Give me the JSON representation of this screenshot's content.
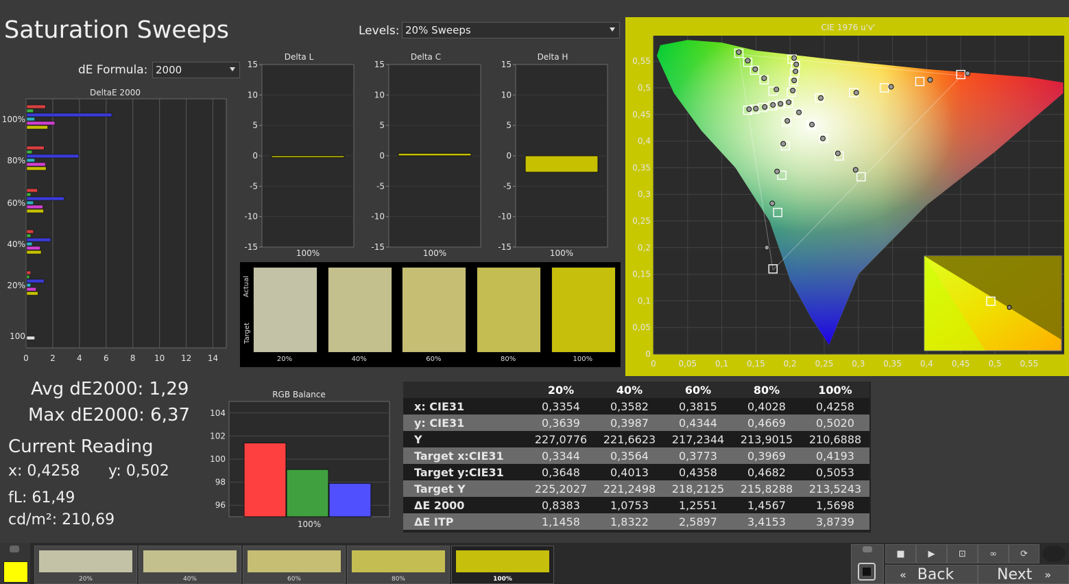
{
  "title": "Saturation Sweeps",
  "levels": {
    "label": "Levels:",
    "value": "20% Sweeps"
  },
  "de_formula": {
    "label": "dE Formula:",
    "value": "2000"
  },
  "summary": {
    "avg": "Avg dE2000: 1,29",
    "max": "Max dE2000: 6,37",
    "current_title": "Current Reading",
    "x": "x: 0,4258",
    "y": "y: 0,502",
    "fl": "fL: 61,49",
    "cdm": "cd/m²: 210,69"
  },
  "colors": {
    "bg": "#3a3a3a",
    "plot_bg": "#2b2b2b",
    "yellow": "#c6c000",
    "highlight_border": "#c8c800"
  },
  "chart_data": [
    {
      "type": "bar",
      "title": "DeltaE 2000",
      "orientation": "horizontal",
      "xlim": [
        0,
        15
      ],
      "x_ticks": [
        "0",
        "2",
        "4",
        "6",
        "8",
        "10",
        "12",
        "14"
      ],
      "categories": [
        "100%",
        "80%",
        "60%",
        "40%",
        "20%",
        "100"
      ],
      "series": [
        {
          "color": "#d94040",
          "values": [
            1.4,
            1.3,
            0.8,
            0.5,
            0.3,
            null
          ]
        },
        {
          "color": "#40b040",
          "values": [
            0.5,
            0.4,
            0.3,
            0.3,
            0.2,
            null
          ]
        },
        {
          "color": "#3b3bd9",
          "values": [
            6.37,
            3.9,
            2.8,
            1.8,
            1.3,
            null
          ]
        },
        {
          "color": "#30b0c0",
          "values": [
            0.6,
            0.6,
            0.5,
            0.4,
            0.3,
            null
          ]
        },
        {
          "color": "#d040d0",
          "values": [
            2.1,
            1.4,
            1.2,
            1.0,
            0.7,
            null
          ]
        },
        {
          "color": "#c6c000",
          "values": [
            1.57,
            1.45,
            1.26,
            1.08,
            0.84,
            null
          ]
        },
        {
          "color": "#e0e0e0",
          "values": [
            null,
            null,
            null,
            null,
            null,
            0.6
          ]
        }
      ]
    },
    {
      "type": "bar",
      "title": "Delta L",
      "ylim": [
        -15,
        15
      ],
      "y_ticks": [
        "15",
        "10",
        "5",
        "0",
        "-5",
        "-10",
        "-15"
      ],
      "categories": [
        "100%"
      ],
      "values": [
        -0.3
      ]
    },
    {
      "type": "bar",
      "title": "Delta C",
      "ylim": [
        -15,
        15
      ],
      "y_ticks": [
        "15",
        "10",
        "5",
        "0",
        "-5",
        "-10",
        "-15"
      ],
      "categories": [
        "100%"
      ],
      "values": [
        0.4
      ]
    },
    {
      "type": "bar",
      "title": "Delta H",
      "ylim": [
        -15,
        15
      ],
      "y_ticks": [
        "15",
        "10",
        "5",
        "0",
        "-5",
        "-10",
        "-15"
      ],
      "categories": [
        "100%"
      ],
      "values": [
        -2.7
      ]
    },
    {
      "type": "bar",
      "title": "RGB Balance",
      "ylim": [
        95,
        105
      ],
      "y_ticks": [
        "104",
        "102",
        "100",
        "98",
        "96"
      ],
      "categories": [
        "100%"
      ],
      "series": [
        {
          "color": "#ff4040",
          "values": [
            101.4
          ]
        },
        {
          "color": "#40a040",
          "values": [
            99.1
          ]
        },
        {
          "color": "#5050ff",
          "values": [
            97.9
          ]
        }
      ]
    },
    {
      "type": "scatter",
      "title": "CIE 1976 u'v'",
      "xlim": [
        0,
        0.6
      ],
      "ylim": [
        0,
        0.6
      ],
      "x_ticks": [
        "0",
        "0,05",
        "0,1",
        "0,15",
        "0,2",
        "0,25",
        "0,3",
        "0,35",
        "0,4",
        "0,45",
        "0,5",
        "0,55"
      ],
      "y_ticks": [
        "0",
        "0,05",
        "0,1",
        "0,15",
        "0,2",
        "0,25",
        "0,3",
        "0,35",
        "0,4",
        "0,45",
        "0,5",
        "0,55"
      ],
      "targets": [
        [
          0.125,
          0.565
        ],
        [
          0.138,
          0.548
        ],
        [
          0.148,
          0.533
        ],
        [
          0.162,
          0.515
        ],
        [
          0.175,
          0.494
        ],
        [
          0.198,
          0.471
        ],
        [
          0.203,
          0.554
        ],
        [
          0.208,
          0.542
        ],
        [
          0.207,
          0.528
        ],
        [
          0.205,
          0.512
        ],
        [
          0.202,
          0.492
        ],
        [
          0.138,
          0.458
        ],
        [
          0.148,
          0.46
        ],
        [
          0.16,
          0.463
        ],
        [
          0.174,
          0.466
        ],
        [
          0.185,
          0.469
        ],
        [
          0.212,
          0.452
        ],
        [
          0.231,
          0.43
        ],
        [
          0.249,
          0.405
        ],
        [
          0.272,
          0.372
        ],
        [
          0.304,
          0.333
        ],
        [
          0.195,
          0.436
        ],
        [
          0.193,
          0.391
        ],
        [
          0.188,
          0.336
        ],
        [
          0.182,
          0.266
        ],
        [
          0.175,
          0.16
        ],
        [
          0.243,
          0.481
        ],
        [
          0.293,
          0.491
        ],
        [
          0.338,
          0.5
        ],
        [
          0.39,
          0.512
        ],
        [
          0.45,
          0.525
        ]
      ],
      "measured": [
        [
          0.125,
          0.567
        ],
        [
          0.138,
          0.551
        ],
        [
          0.149,
          0.535
        ],
        [
          0.162,
          0.518
        ],
        [
          0.18,
          0.497
        ],
        [
          0.198,
          0.473
        ],
        [
          0.206,
          0.556
        ],
        [
          0.209,
          0.544
        ],
        [
          0.208,
          0.531
        ],
        [
          0.206,
          0.514
        ],
        [
          0.204,
          0.495
        ],
        [
          0.14,
          0.46
        ],
        [
          0.15,
          0.461
        ],
        [
          0.163,
          0.464
        ],
        [
          0.175,
          0.468
        ],
        [
          0.186,
          0.47
        ],
        [
          0.213,
          0.454
        ],
        [
          0.232,
          0.431
        ],
        [
          0.248,
          0.405
        ],
        [
          0.27,
          0.377
        ],
        [
          0.296,
          0.346
        ],
        [
          0.196,
          0.438
        ],
        [
          0.19,
          0.395
        ],
        [
          0.181,
          0.343
        ],
        [
          0.174,
          0.283
        ],
        [
          0.166,
          0.2
        ],
        [
          0.245,
          0.481
        ],
        [
          0.297,
          0.491
        ],
        [
          0.348,
          0.502
        ],
        [
          0.405,
          0.515
        ],
        [
          0.46,
          0.527
        ]
      ]
    }
  ],
  "sweep_swatches": {
    "actual_label": "Actual",
    "target_label": "Target",
    "labels": [
      "20%",
      "40%",
      "60%",
      "80%",
      "100%"
    ],
    "colors": [
      "#c3c2a6",
      "#c4c08d",
      "#c5be73",
      "#c4bd52",
      "#c6bf0c"
    ]
  },
  "table": {
    "headers": [
      "",
      "20%",
      "40%",
      "60%",
      "80%",
      "100%"
    ],
    "rows": [
      {
        "label": "x: CIE31",
        "values": [
          "0,3354",
          "0,3582",
          "0,3815",
          "0,4028",
          "0,4258"
        ]
      },
      {
        "label": "y: CIE31",
        "values": [
          "0,3639",
          "0,3987",
          "0,4344",
          "0,4669",
          "0,5020"
        ]
      },
      {
        "label": "Y",
        "values": [
          "227,0776",
          "221,6623",
          "217,2344",
          "213,9015",
          "210,6888"
        ]
      },
      {
        "label": "Target x:CIE31",
        "values": [
          "0,3344",
          "0,3564",
          "0,3773",
          "0,3969",
          "0,4193"
        ]
      },
      {
        "label": "Target y:CIE31",
        "values": [
          "0,3648",
          "0,4013",
          "0,4358",
          "0,4682",
          "0,5053"
        ]
      },
      {
        "label": "Target Y",
        "values": [
          "225,2027",
          "221,2498",
          "218,2125",
          "215,8288",
          "213,5243"
        ]
      },
      {
        "label": "ΔE 2000",
        "values": [
          "0,8383",
          "1,0753",
          "1,2551",
          "1,4567",
          "1,5698"
        ]
      },
      {
        "label": "ΔE ITP",
        "values": [
          "1,1458",
          "1,8322",
          "2,5897",
          "3,4153",
          "3,8739"
        ]
      }
    ]
  },
  "bottom_bar": {
    "current_color": "#ffff00",
    "tiles": [
      {
        "label": "20%",
        "color": "#c3c2a6"
      },
      {
        "label": "40%",
        "color": "#c4c08d"
      },
      {
        "label": "60%",
        "color": "#c5be73"
      },
      {
        "label": "80%",
        "color": "#c4bd52"
      },
      {
        "label": "100%",
        "color": "#c6bf0c"
      }
    ],
    "back_label": "Back",
    "next_label": "Next"
  }
}
